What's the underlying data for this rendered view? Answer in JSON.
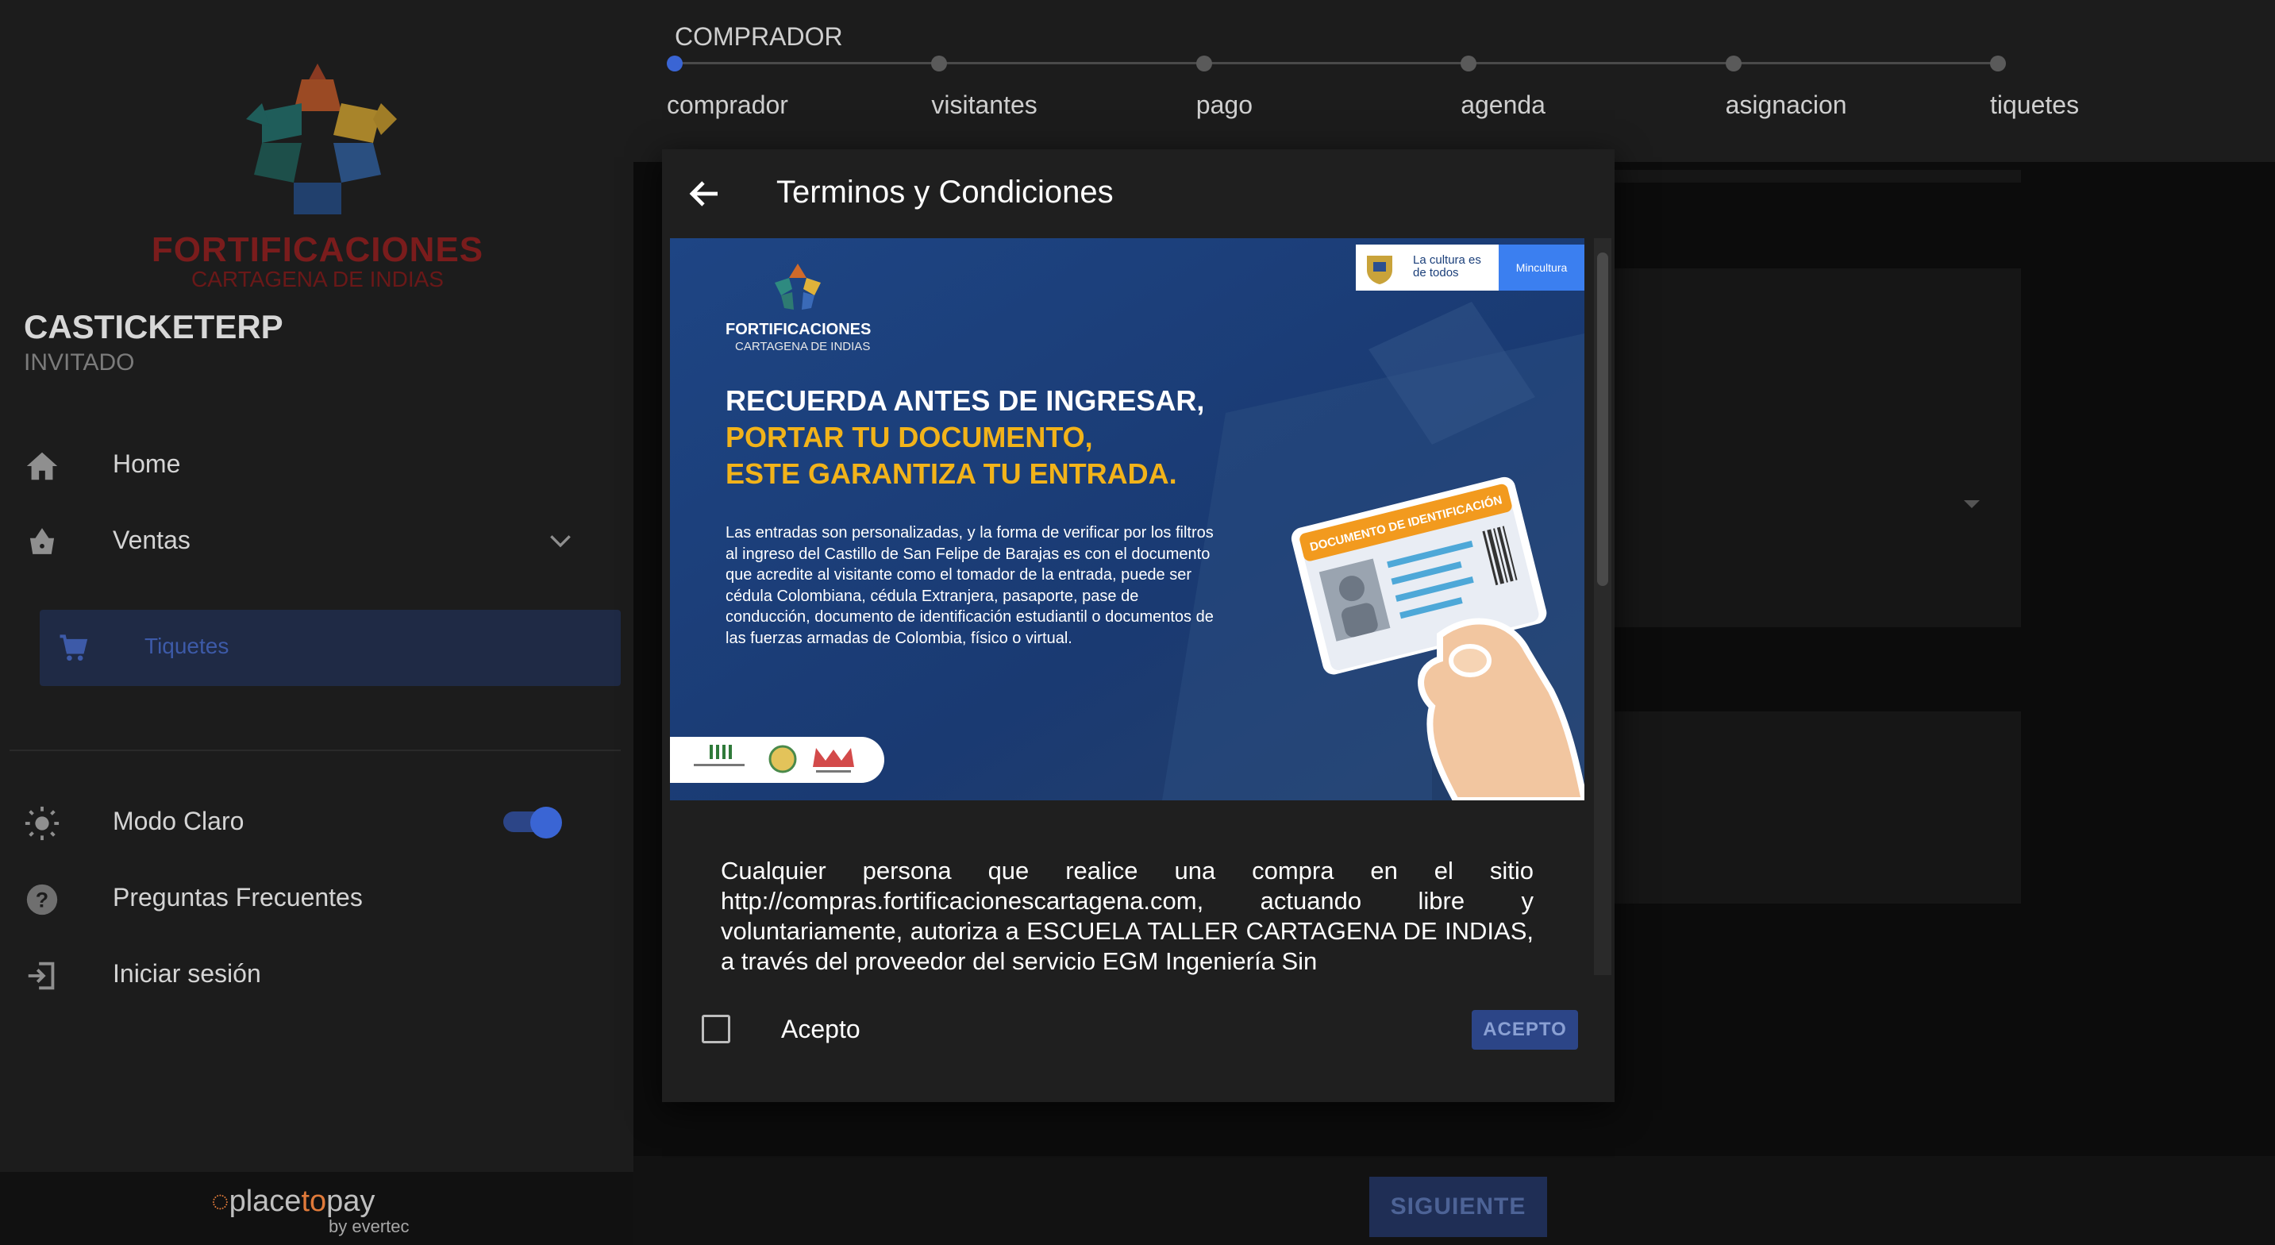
{
  "sidebar": {
    "logo": {
      "title": "FORTIFICACIONES",
      "subtitle": "CARTAGENA DE INDIAS"
    },
    "brand": "CASTICKETERP",
    "role": "INVITADO",
    "nav": {
      "home": {
        "label": "Home",
        "icon": "home-icon"
      },
      "ventas": {
        "label": "Ventas",
        "icon": "basket-icon"
      },
      "tiquetes": {
        "label": "Tiquetes",
        "icon": "cart-icon"
      },
      "modo": {
        "label": "Modo Claro",
        "icon": "sun-icon",
        "enabled": true
      },
      "faq": {
        "label": "Preguntas Frecuentes",
        "icon": "help-icon"
      },
      "login": {
        "label": "Iniciar sesión",
        "icon": "login-icon"
      }
    },
    "footer": {
      "brand_a": "place",
      "brand_b": "to",
      "brand_c": "pay",
      "by": "by evertec"
    }
  },
  "stepper": {
    "title": "COMPRADOR",
    "steps": [
      "comprador",
      "visitantes",
      "pago",
      "agenda",
      "asignacion",
      "tiquetes"
    ],
    "active_index": 0
  },
  "dialog": {
    "title": "Terminos y Condiciones",
    "banner": {
      "logo_title": "FORTIFICACIONES",
      "logo_sub": "CARTAGENA DE INDIAS",
      "ministry_left": "La cultura es de todos",
      "ministry_right": "Mincultura",
      "headline_1": "RECUERDA ANTES DE INGRESAR,",
      "headline_2": "PORTAR TU DOCUMENTO,",
      "headline_3": "ESTE GARANTIZA TU ENTRADA.",
      "body": "Las entradas son personalizadas, y la forma de verificar por los filtros al ingreso del Castillo de San Felipe de Barajas es con el documento que acredite al visitante como el tomador de la entrada, puede ser cédula Colombiana, cédula Extranjera, pasaporte, pase de conducción, documento de identificación estudiantil o documentos de las fuerzas armadas de Colombia, físico o virtual.",
      "card_title": "DOCUMENTO DE IDENTIFICACIÓN"
    },
    "terms": "Cualquier persona que realice una compra en el sitio http://compras.fortificacionescartagena.com, actuando libre y voluntariamente, autoriza a ESCUELA TALLER CARTAGENA DE INDIAS, a través del proveedor del servicio EGM Ingeniería Sin",
    "accept_label": "Acepto",
    "accept_button": "ACEPTO"
  },
  "actions": {
    "next": "SIGUIENTE"
  },
  "colors": {
    "accent": "#3a65d4",
    "banner_blue": "#1a3d77",
    "banner_yellow": "#f2b31a",
    "dark": "#1c1c1c"
  }
}
